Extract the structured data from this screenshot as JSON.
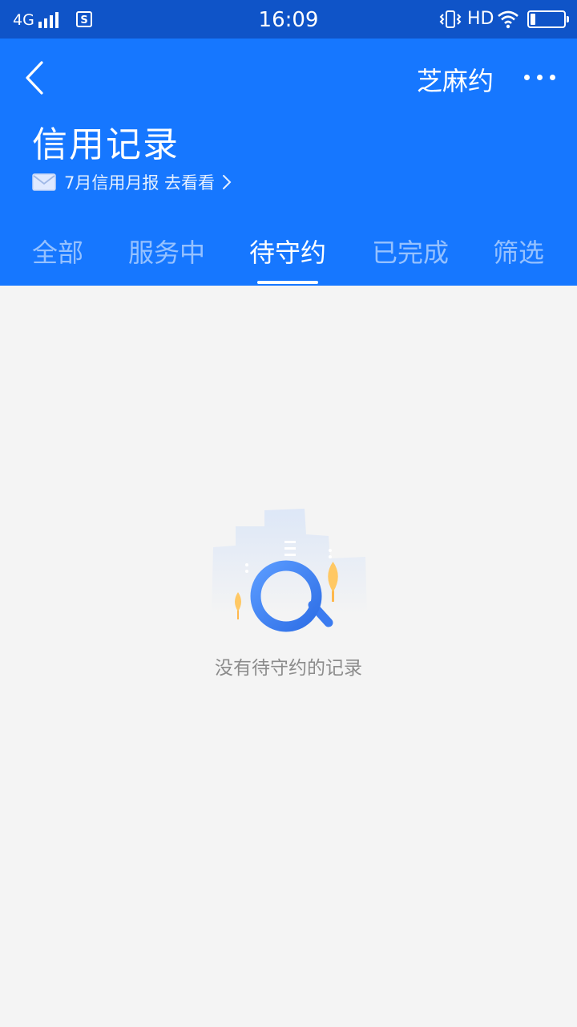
{
  "status_bar": {
    "network": "4G",
    "time": "16:09",
    "hd_label": "HD"
  },
  "header": {
    "back_icon": "chevron-left-icon",
    "brand_link": "芝麻约",
    "more_icon": "more-dots-icon",
    "title": "信用记录",
    "report": {
      "icon": "envelope-icon",
      "label": "7月信用月报 去看看"
    }
  },
  "tabs": [
    {
      "label": "全部",
      "active": false
    },
    {
      "label": "服务中",
      "active": false
    },
    {
      "label": "待守约",
      "active": true
    },
    {
      "label": "已完成",
      "active": false
    },
    {
      "label": "筛选",
      "active": false
    }
  ],
  "empty_state": {
    "illustration": "magnifier-city-illustration",
    "message": "没有待守约的记录"
  },
  "colors": {
    "status_bar_bg": "#0f54c8",
    "header_bg": "#1677ff",
    "page_bg": "#f4f4f4",
    "accent_orange": "#ffb84d"
  }
}
